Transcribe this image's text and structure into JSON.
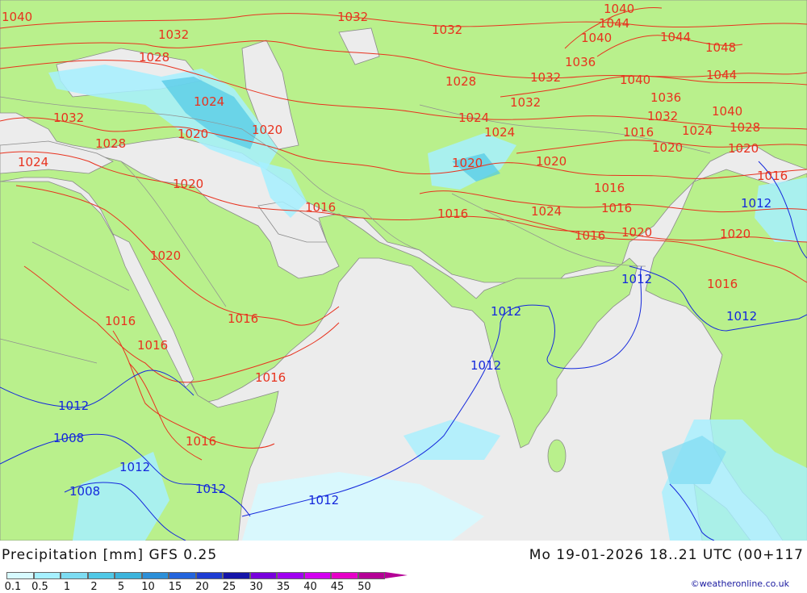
{
  "header": {
    "title_left": "Precipitation [mm]  GFS 0.25",
    "title_right": "Mo 19-01-2026 18..21 UTC (00+117"
  },
  "credit": "©weatheronline.co.uk",
  "colors": {
    "sea": "#ececec",
    "land": "#b9f08c",
    "isobar_high": "#e8321e",
    "isobar_low": "#1428dc",
    "border": "#a0a0a0",
    "precip_light": "#a6f0ff",
    "precip_mid": "#50c8e6"
  },
  "legend": {
    "items": [
      {
        "label": "0.1",
        "color": "#d7faff"
      },
      {
        "label": "0.5",
        "color": "#a6f0ff"
      },
      {
        "label": "1",
        "color": "#7ddcf2"
      },
      {
        "label": "2",
        "color": "#50c8e6"
      },
      {
        "label": "5",
        "color": "#3cb4dc"
      },
      {
        "label": "10",
        "color": "#2c8fd8"
      },
      {
        "label": "15",
        "color": "#2364dc"
      },
      {
        "label": "20",
        "color": "#1e3cd2"
      },
      {
        "label": "25",
        "color": "#1414a8"
      },
      {
        "label": "30",
        "color": "#7800dc"
      },
      {
        "label": "35",
        "color": "#a000f0"
      },
      {
        "label": "40",
        "color": "#d200f0"
      },
      {
        "label": "45",
        "color": "#e600c8"
      },
      {
        "label": "50",
        "color": "#b40096"
      }
    ]
  },
  "isobar_labels": {
    "high": [
      {
        "text": "1040"
      },
      {
        "text": "1032"
      },
      {
        "text": "1032"
      },
      {
        "text": "1032"
      },
      {
        "text": "1028"
      },
      {
        "text": "1024"
      },
      {
        "text": "1032"
      },
      {
        "text": "1020"
      },
      {
        "text": "1020"
      },
      {
        "text": "1028"
      },
      {
        "text": "1024"
      },
      {
        "text": "1020"
      },
      {
        "text": "1016"
      },
      {
        "text": "1020"
      },
      {
        "text": "1016"
      },
      {
        "text": "1016"
      },
      {
        "text": "1016"
      },
      {
        "text": "1016"
      },
      {
        "text": "1040"
      },
      {
        "text": "1044"
      },
      {
        "text": "1040"
      },
      {
        "text": "1044"
      },
      {
        "text": "1048"
      },
      {
        "text": "1036"
      },
      {
        "text": "1028"
      },
      {
        "text": "1032"
      },
      {
        "text": "1040"
      },
      {
        "text": "1044"
      },
      {
        "text": "1032"
      },
      {
        "text": "1036"
      },
      {
        "text": "1024"
      },
      {
        "text": "1032"
      },
      {
        "text": "1040"
      },
      {
        "text": "1024"
      },
      {
        "text": "1016"
      },
      {
        "text": "1024"
      },
      {
        "text": "1028"
      },
      {
        "text": "1020"
      },
      {
        "text": "1020"
      },
      {
        "text": "1020"
      },
      {
        "text": "1020"
      },
      {
        "text": "1016"
      },
      {
        "text": "1016"
      },
      {
        "text": "1024"
      },
      {
        "text": "1016"
      },
      {
        "text": "1016"
      },
      {
        "text": "1016"
      },
      {
        "text": "1020"
      },
      {
        "text": "1020"
      },
      {
        "text": "1016"
      },
      {
        "text": "1016"
      }
    ],
    "low": [
      {
        "text": "1012"
      },
      {
        "text": "1012"
      },
      {
        "text": "1012"
      },
      {
        "text": "1012"
      },
      {
        "text": "1012"
      },
      {
        "text": "1012"
      },
      {
        "text": "1008"
      },
      {
        "text": "1012"
      },
      {
        "text": "1008"
      },
      {
        "text": "1012"
      },
      {
        "text": "1012"
      }
    ]
  }
}
